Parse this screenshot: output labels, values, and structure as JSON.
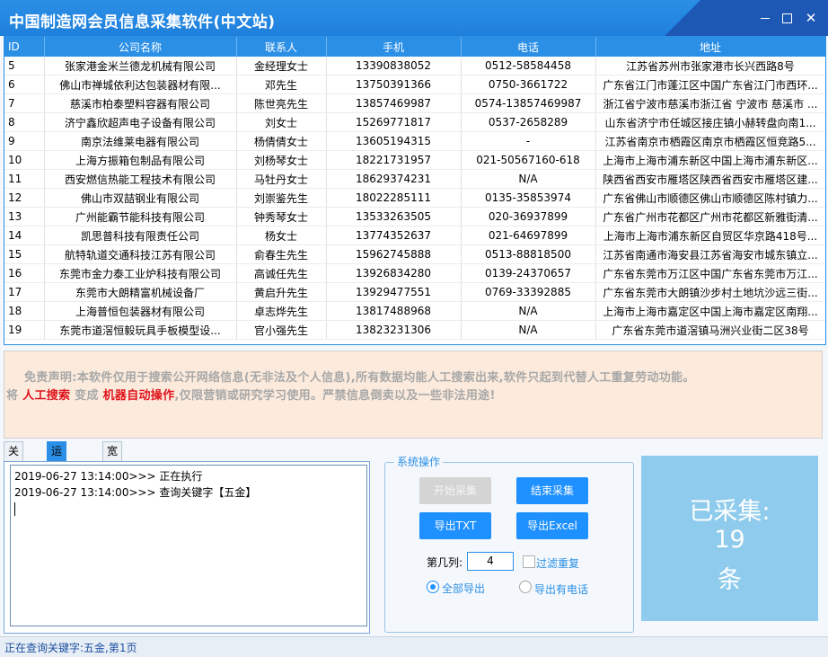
{
  "window": {
    "title": "中国制造网会员信息采集软件(中文站)",
    "minimize_label": "—",
    "close_label": "✕"
  },
  "table": {
    "headers": [
      "ID",
      "公司名称",
      "联系人",
      "手机",
      "电话",
      "地址"
    ],
    "rows": [
      [
        "5",
        "张家港金米兰德龙机械有限公司",
        "金经理女士",
        "13390838052",
        "0512-58584458",
        "江苏省苏州市张家港市长兴西路8号"
      ],
      [
        "6",
        "佛山市禅城依利达包装器材有限...",
        "邓先生",
        "13750391366",
        "0750-3661722",
        "广东省江门市蓬江区中国广东省江门市西环..."
      ],
      [
        "7",
        "慈溪市柏泰塑料容器有限公司",
        "陈世亮先生",
        "13857469987",
        "0574-13857469987",
        "浙江省宁波市慈溪市浙江省 宁波市 慈溪市 ..."
      ],
      [
        "8",
        "济宁鑫欣超声电子设备有限公司",
        "刘女士",
        "15269771817",
        "0537-2658289",
        "山东省济宁市任城区接庄镇小赫转盘向南1..."
      ],
      [
        "9",
        "南京法维莱电器有限公司",
        "杨倩倩女士",
        "13605194315",
        "-",
        "江苏省南京市栖霞区南京市栖霞区恒竞路5..."
      ],
      [
        "10",
        "上海方振箱包制品有限公司",
        "刘杨琴女士",
        "18221731957",
        "021-50567160-618",
        "上海市上海市浦东新区中国上海市浦东新区..."
      ],
      [
        "11",
        "西安燃信热能工程技术有限公司",
        "马牡丹女士",
        "18629374231",
        "N/A",
        "陕西省西安市雁塔区陕西省西安市雁塔区建..."
      ],
      [
        "12",
        "佛山市双喆钢业有限公司",
        "刘崇鉴先生",
        "18022285111",
        "0135-35853974",
        "广东省佛山市顺德区佛山市顺德区陈村镇力..."
      ],
      [
        "13",
        "广州能霸节能科技有限公司",
        "钟秀琴女士",
        "13533263505",
        "020-36937899",
        "广东省广州市花都区广州市花都区新雅街清..."
      ],
      [
        "14",
        "凯思普科技有限责任公司",
        "杨女士",
        "13774352637",
        "021-64697899",
        "上海市上海市浦东新区自贸区华京路418号..."
      ],
      [
        "15",
        "航特轨道交通科技江苏有限公司",
        "俞春生先生",
        "15962745888",
        "0513-88818500",
        "江苏省南通市海安县江苏省海安市城东镇立..."
      ],
      [
        "16",
        "东莞市金力泰工业炉科技有限公司",
        "高诚任先生",
        "13926834280",
        "0139-24370657",
        "广东省东莞市万江区中国广东省东莞市万江..."
      ],
      [
        "17",
        "东莞市大朗精富机械设备厂",
        "黄启升先生",
        "13929477551",
        "0769-33392885",
        "广东省东莞市大朗镇沙步村土地坑沙远三街..."
      ],
      [
        "18",
        "上海普恒包装器材有限公司",
        "卓志烨先生",
        "13817488968",
        "N/A",
        "上海市上海市嘉定区中国上海市嘉定区南翔..."
      ],
      [
        "19",
        "东莞市道滘恒毅玩具手板模型设...",
        "官小强先生",
        "13823231306",
        "N/A",
        "广东省东莞市道滘镇马洲兴业街二区38号"
      ]
    ]
  },
  "notice": {
    "line1": "免责声明:本软件仅用于搜索公开网络信息(无非法及个人信息),所有数据均能人工搜索出来,软件只起到代替人工重复劳动功能。",
    "line2_a": "将 ",
    "highlight1": "人工搜索",
    "line2_b": " 变成 ",
    "highlight2": "机器自动操作",
    "line2_c": ",仅限营销或研究学习使用。严禁信息倒卖以及一些非法用途!"
  },
  "tabs": [
    "关键词",
    "运行日志",
    "宽带拨号"
  ],
  "active_tab": "运行日志",
  "log": [
    "2019-06-27 13:14:00>>> 正在执行",
    "2019-06-27 13:14:00>>> 查询关键字【五金】"
  ],
  "ops": {
    "legend": "系统操作",
    "start_label": "开始采集",
    "stop_label": "结束采集",
    "export_txt_label": "导出TXT",
    "export_excel_label": "导出Excel",
    "column_label": "第几列:",
    "column_value": "4",
    "filter_dup_label": "过滤重复",
    "filter_dup_checked": false,
    "export_all_label": "全部导出",
    "export_all_selected": true,
    "export_phone_label": "导出有电话",
    "export_phone_selected": false
  },
  "count": {
    "label": "已采集:",
    "value": "19",
    "unit": "条"
  },
  "status": {
    "text": "正在查询关键字:五金,第1页"
  }
}
